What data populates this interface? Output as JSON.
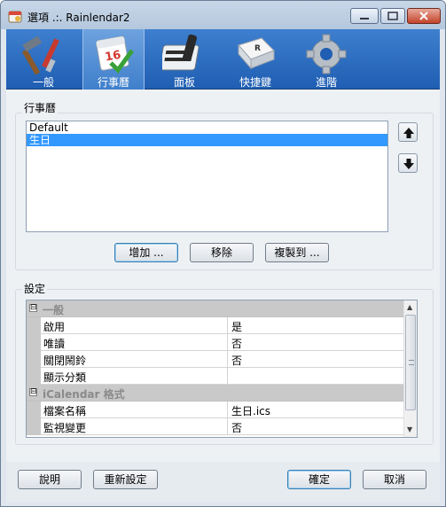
{
  "window": {
    "title": "選項 .:. Rainlendar2"
  },
  "toolbar": {
    "items": [
      {
        "label": "一般",
        "icon": "tools-icon"
      },
      {
        "label": "行事曆",
        "icon": "calendar-icon",
        "day": "16"
      },
      {
        "label": "面板",
        "icon": "panel-icon"
      },
      {
        "label": "快捷鍵",
        "icon": "key-icon",
        "key_letter": "R"
      },
      {
        "label": "進階",
        "icon": "gear-icon"
      }
    ],
    "active_index": 1
  },
  "calendars": {
    "group_label": "行事曆",
    "items": [
      {
        "label": "Default",
        "selected": false
      },
      {
        "label": "生日",
        "selected": true
      }
    ],
    "add_label": "增加 ...",
    "remove_label": "移除",
    "copy_label": "複製到 ..."
  },
  "settings": {
    "group_label": "設定",
    "categories": [
      {
        "name": "一般",
        "toggle": "⊟",
        "rows": [
          {
            "name": "啟用",
            "value": "是"
          },
          {
            "name": "唯讀",
            "value": "否"
          },
          {
            "name": "關閉鬧鈴",
            "value": "否"
          },
          {
            "name": "顯示分類",
            "value": ""
          }
        ]
      },
      {
        "name": "iCalendar 格式",
        "toggle": "⊟",
        "rows": [
          {
            "name": "檔案名稱",
            "value": "生日.ics"
          },
          {
            "name": "監視變更",
            "value": "否"
          }
        ]
      }
    ]
  },
  "footer": {
    "help_label": "說明",
    "reset_label": "重新設定",
    "ok_label": "確定",
    "cancel_label": "取消"
  }
}
